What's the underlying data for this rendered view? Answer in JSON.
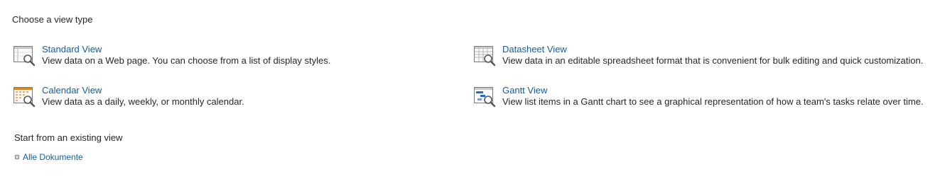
{
  "choose_section": {
    "heading": "Choose a view type",
    "options": [
      {
        "title": "Standard View",
        "description": "View data on a Web page. You can choose from a list of display styles.",
        "icon": "standard-view-icon"
      },
      {
        "title": "Datasheet View",
        "description": "View data in an editable spreadsheet format that is convenient for bulk editing and quick customization.",
        "icon": "datasheet-view-icon"
      },
      {
        "title": "Calendar View",
        "description": "View data as a daily, weekly, or monthly calendar.",
        "icon": "calendar-view-icon"
      },
      {
        "title": "Gantt View",
        "description": "View list items in a Gantt chart to see a graphical representation of how a team's tasks relate over time.",
        "icon": "gantt-view-icon"
      }
    ]
  },
  "existing_section": {
    "heading": "Start from an existing view",
    "items": [
      {
        "label": "Alle Dokumente",
        "icon": "bullet-icon"
      }
    ]
  },
  "colors": {
    "link": "#0f5ea5",
    "text": "#262626",
    "icon_outline": "#7a7a7a",
    "gantt_accent": "#1f6fc4",
    "calendar_accent": "#d9892c"
  }
}
